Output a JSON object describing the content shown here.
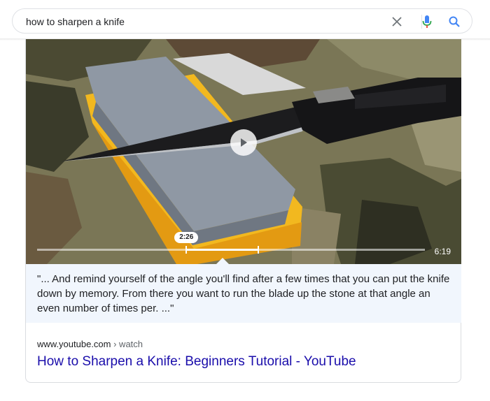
{
  "search": {
    "query": "how to sharpen a knife",
    "clear_icon": "close-icon",
    "voice_icon": "microphone-icon",
    "search_icon": "search-icon"
  },
  "video": {
    "current_time": "2:26",
    "duration": "6:19",
    "progress_fraction": 0.385,
    "segment_end_fraction": 0.57,
    "play_icon": "play-icon"
  },
  "snippet": {
    "quote": "\"... And remind yourself of the angle you'll find after a few times that you can put the knife down by memory. From there you want to run the blade up the stone at that angle an even number of times per. ...\""
  },
  "result": {
    "site": "www.youtube.com",
    "path": " › watch",
    "title": "How to Sharpen a Knife: Beginners Tutorial - YouTube"
  },
  "colors": {
    "link": "#1a0dab",
    "snippet_bg": "#f1f6fd",
    "mic_blue": "#4285f4",
    "mic_red": "#ea4335"
  }
}
